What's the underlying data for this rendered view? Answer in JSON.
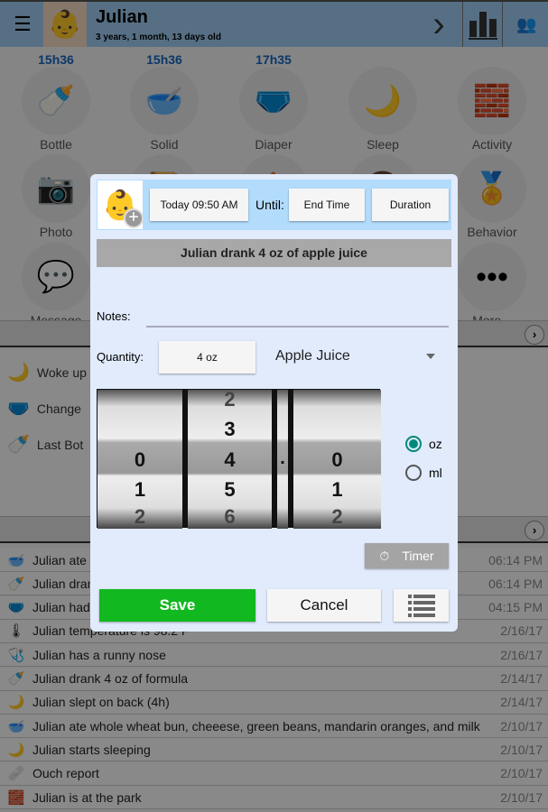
{
  "header": {
    "name": "Julian",
    "age": "3 years, 1 month, 13 days old",
    "menu_icon": "hamburger-icon",
    "next_icon": "chevron-right-icon",
    "stats_icon": "bar-chart-icon",
    "settings_icon": "people-icon"
  },
  "grid": [
    {
      "label": "Bottle",
      "time": "15h36",
      "icon": "bottle-icon",
      "glyph": "🍼"
    },
    {
      "label": "Solid",
      "time": "15h36",
      "icon": "bowl-icon",
      "glyph": "🥣"
    },
    {
      "label": "Diaper",
      "time": "17h35",
      "icon": "diaper-icon",
      "glyph": "🩲"
    },
    {
      "label": "Sleep",
      "time": "",
      "icon": "moon-icon",
      "glyph": "🌙"
    },
    {
      "label": "Activity",
      "time": "",
      "icon": "blocks-icon",
      "glyph": "🧱"
    },
    {
      "label": "Photo",
      "time": "",
      "icon": "camera-icon",
      "glyph": "📷"
    },
    {
      "label": "",
      "time": "",
      "icon": "journal-icon",
      "glyph": "📔"
    },
    {
      "label": "",
      "time": "",
      "icon": "house-icon",
      "glyph": "🏠"
    },
    {
      "label": "",
      "time": "",
      "icon": "face-icon",
      "glyph": "👦"
    },
    {
      "label": "Behavior",
      "time": "",
      "icon": "medal-icon",
      "glyph": "🏅"
    },
    {
      "label": "Message",
      "time": "",
      "icon": "speech-bubble-icon",
      "glyph": "💬"
    },
    {
      "label": "",
      "time": "",
      "icon": "",
      "glyph": ""
    },
    {
      "label": "",
      "time": "",
      "icon": "",
      "glyph": ""
    },
    {
      "label": "",
      "time": "",
      "icon": "",
      "glyph": ""
    },
    {
      "label": "More...",
      "time": "",
      "icon": "more-icon",
      "glyph": "•••"
    }
  ],
  "summary": [
    {
      "text": "Woke up",
      "glyph": "🌙"
    },
    {
      "text": "Change",
      "glyph": "🩲"
    },
    {
      "text": "Last Bot",
      "glyph": "🍼"
    }
  ],
  "history": [
    {
      "text": "Julian ate",
      "date": "06:14 PM",
      "glyph": "🥣"
    },
    {
      "text": "Julian dran",
      "date": "06:14 PM",
      "glyph": "🍼"
    },
    {
      "text": "Julian had",
      "date": "04:15 PM",
      "glyph": "🩲"
    },
    {
      "text": "Julian temperature is 98.2 F",
      "date": "2/16/17",
      "glyph": "🌡"
    },
    {
      "text": "Julian has a runny nose",
      "date": "2/16/17",
      "glyph": "🩺"
    },
    {
      "text": "Julian drank 4 oz of formula",
      "date": "2/14/17",
      "glyph": "🍼"
    },
    {
      "text": "Julian slept on back (4h)",
      "date": "2/14/17",
      "glyph": "🌙"
    },
    {
      "text": "Julian ate whole wheat bun, cheeese, green beans, mandarin oranges, and milk",
      "date": "2/10/17",
      "glyph": "🥣"
    },
    {
      "text": "Julian starts sleeping",
      "date": "2/10/17",
      "glyph": "🌙"
    },
    {
      "text": "Ouch report",
      "date": "2/10/17",
      "glyph": "🩹"
    },
    {
      "text": "Julian is at the park",
      "date": "2/10/17",
      "glyph": "🧱"
    }
  ],
  "dialog": {
    "start_time": "Today 09:50 AM",
    "until_label": "Until:",
    "end_time": "End Time",
    "duration": "Duration",
    "summary": "Julian drank 4 oz of apple juice",
    "notes_label": "Notes:",
    "notes_value": "",
    "quantity_label": "Quantity:",
    "quantity_value": "4 oz",
    "drink_type": "Apple Juice",
    "wheels": [
      [
        "",
        "",
        "0",
        "1",
        "2"
      ],
      [
        "2",
        "3",
        "4",
        "5",
        "6"
      ],
      [
        "",
        "",
        "0",
        "1",
        "2"
      ]
    ],
    "decimal": ".",
    "units": [
      {
        "label": "oz",
        "selected": true
      },
      {
        "label": "ml",
        "selected": false
      }
    ],
    "timer": "Timer",
    "save": "Save",
    "cancel": "Cancel",
    "colors": {
      "save": "#12b81f",
      "accent": "#00897b"
    }
  }
}
